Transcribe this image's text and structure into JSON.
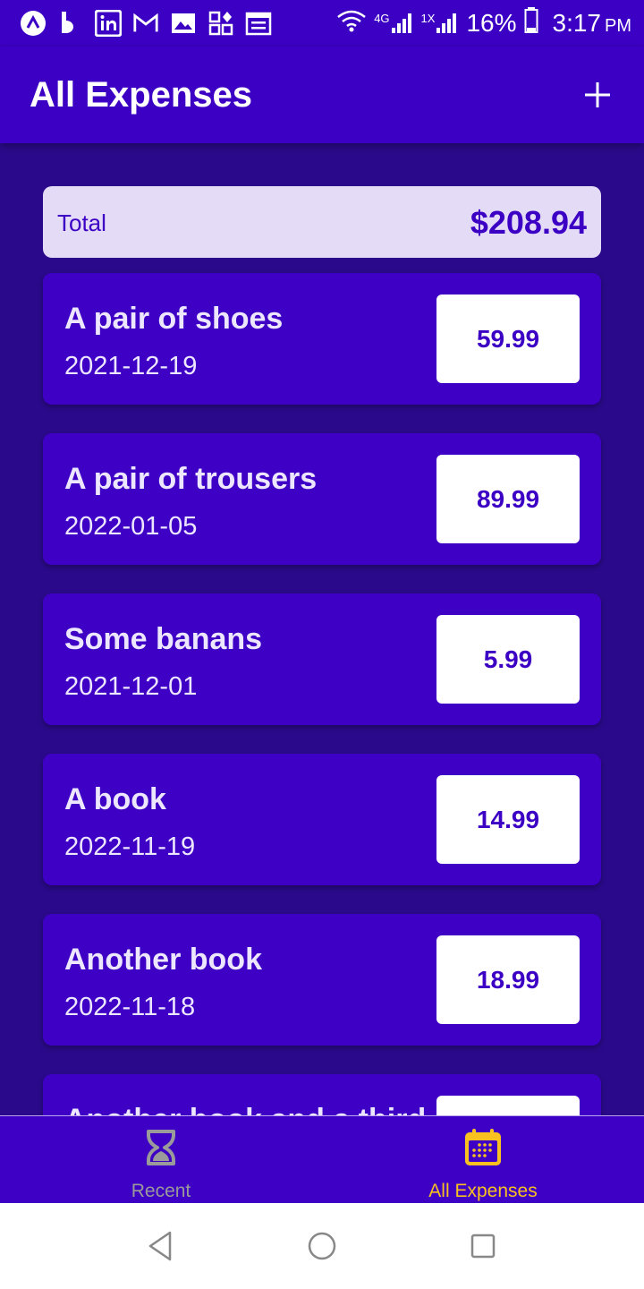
{
  "status_bar": {
    "battery": "16%",
    "time": "3:17",
    "ampm": "PM",
    "network_1": "4G",
    "network_2": "1X"
  },
  "app_bar": {
    "title": "All Expenses",
    "add_icon": "plus-icon"
  },
  "summary": {
    "label": "Total",
    "amount": "$208.94"
  },
  "expenses": [
    {
      "description": "A pair of shoes",
      "date": "2021-12-19",
      "amount": "59.99"
    },
    {
      "description": "A pair of trousers",
      "date": "2022-01-05",
      "amount": "89.99"
    },
    {
      "description": "Some banans",
      "date": "2021-12-01",
      "amount": "5.99"
    },
    {
      "description": "A book",
      "date": "2022-11-19",
      "amount": "14.99"
    },
    {
      "description": "Another book",
      "date": "2022-11-18",
      "amount": "18.99"
    },
    {
      "description": "Another book and a third",
      "date": "",
      "amount": ""
    }
  ],
  "bottom_nav": {
    "tabs": [
      {
        "label": "Recent",
        "icon": "hourglass-icon",
        "active": false
      },
      {
        "label": "All Expenses",
        "icon": "calendar-icon",
        "active": true
      }
    ],
    "active_color": "#f9c11f",
    "inactive_color": "#9a9a9a"
  },
  "colors": {
    "primary": "#3c00c4",
    "background": "#2a0a8a",
    "summary_bg": "#e4dbf7"
  }
}
